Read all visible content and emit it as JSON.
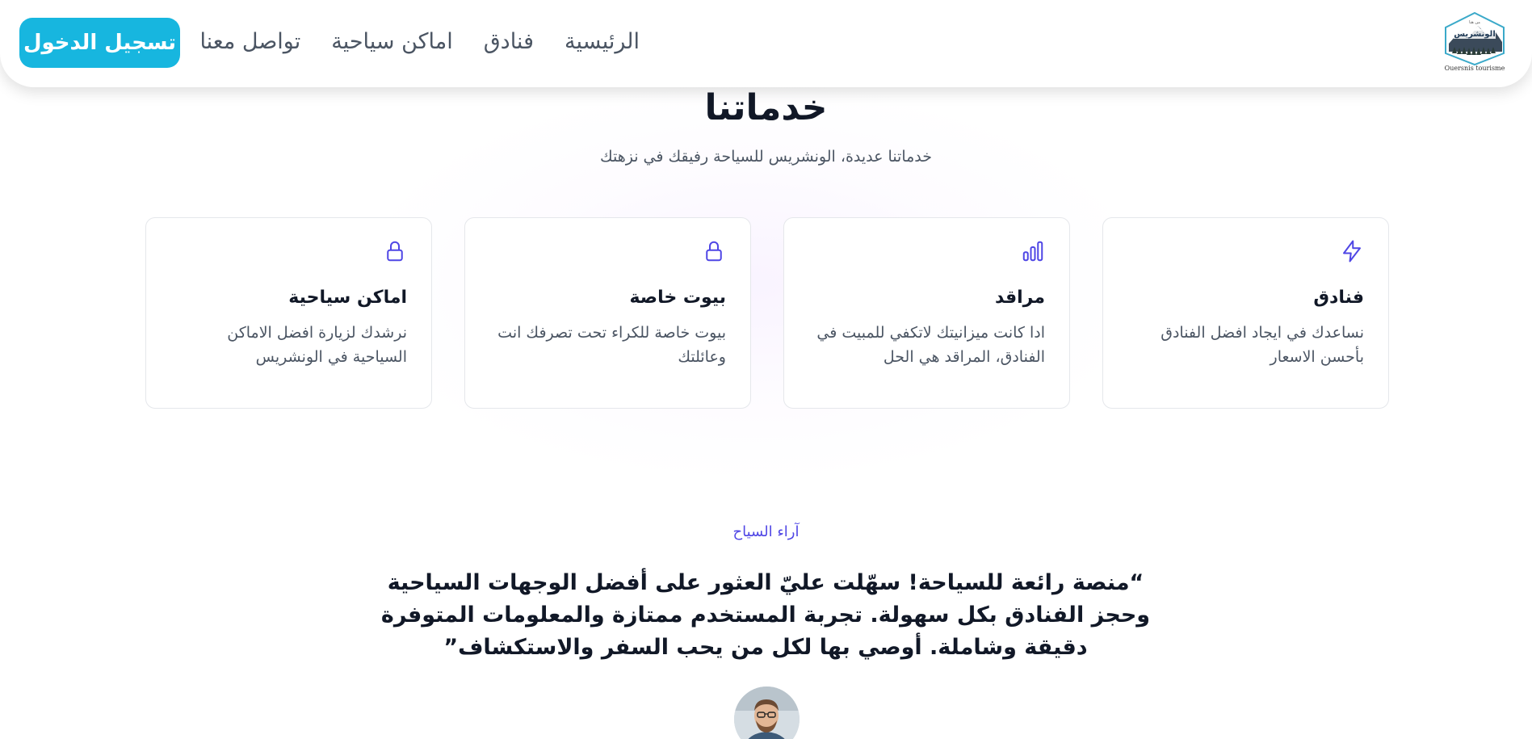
{
  "nav": {
    "logo_text": "الونشريس",
    "logo_small": "من هنا",
    "logo_brand": "Ouersnis tourisme",
    "links": [
      "الرئيسية",
      "فنادق",
      "اماكن سياحية",
      "تواصل معنا"
    ],
    "login_label": "تسجيل الدخول"
  },
  "services": {
    "title": "خدماتنا",
    "subtitle": "خدماتنا عديدة، الونشريس للسياحة رفيقك في نزهتك",
    "cards": [
      {
        "icon": "lightning-icon",
        "title": "فنادق",
        "description": "نساعدك في ايجاد افضل الفنادق بأحسن الاسعار"
      },
      {
        "icon": "bar-chart-icon",
        "title": "مراقد",
        "description": "ادا كانت ميزانيتك لاتكفي للمبيت في الفنادق، المراقد هي الحل"
      },
      {
        "icon": "lock-icon",
        "title": "بيوت خاصة",
        "description": "بيوت خاصة للكراء تحت تصرفك انت وعائلتك"
      },
      {
        "icon": "lock-icon",
        "title": "اماكن سياحية",
        "description": "نرشدك لزيارة افضل الاماكن السياحية في الونشريس"
      }
    ]
  },
  "testimonial": {
    "eyebrow": "آراء السياح",
    "quote": "“منصة رائعة للسياحة! سهّلت عليّ العثور على أفضل الوجهات السياحية وحجز الفنادق بكل سهولة. تجربة المستخدم ممتازة والمعلومات المتوفرة دقيقة وشاملة. أوصي بها لكل من يحب السفر والاستكشاف”",
    "avatar_icon": "avatar"
  },
  "colors": {
    "accent": "#17b6df",
    "icon": "#4f46e5",
    "text": "#111827",
    "muted": "#4b5563"
  }
}
